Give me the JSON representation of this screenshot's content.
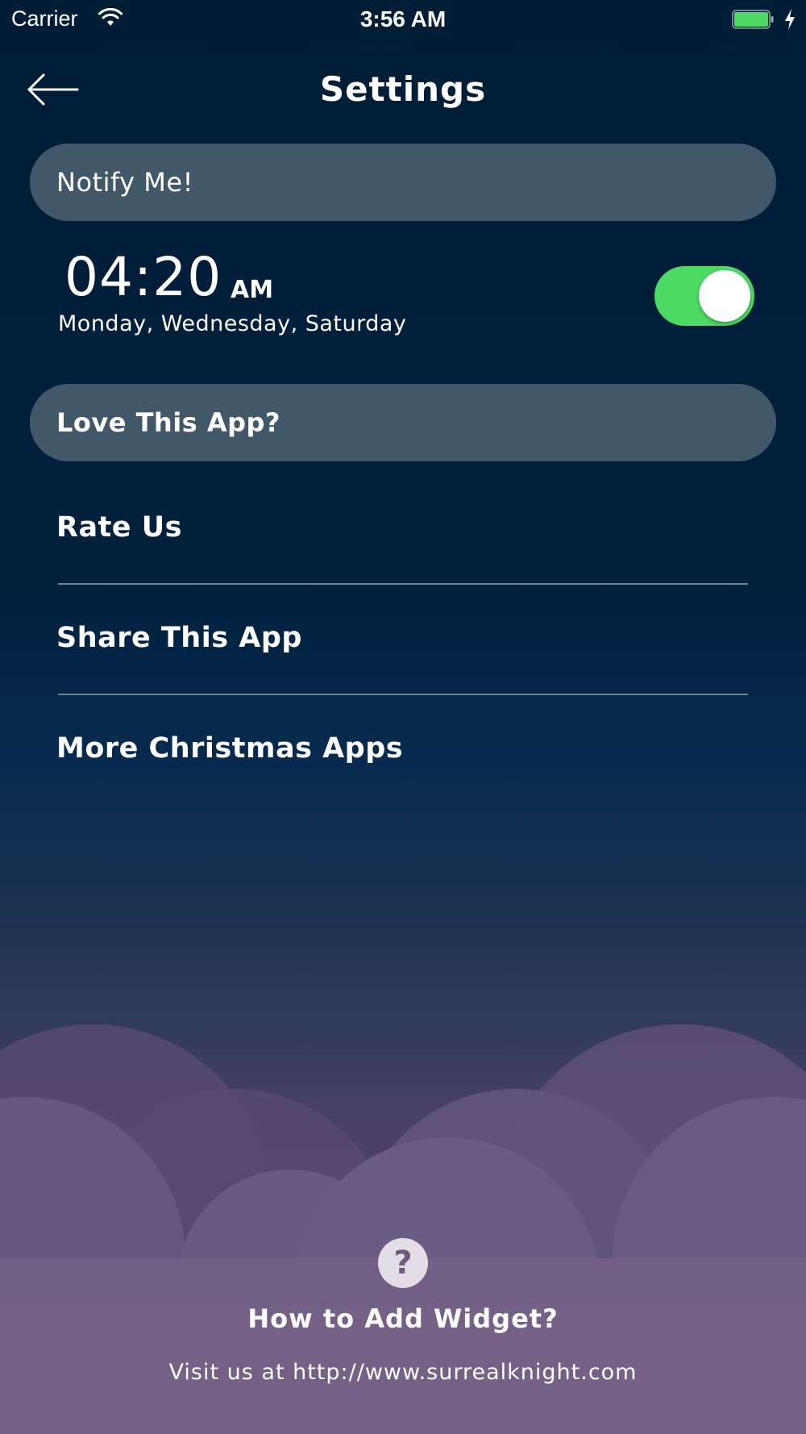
{
  "status_bar": {
    "carrier": "Carrier",
    "time": "3:56 AM",
    "icons": [
      "wifi-icon",
      "battery-icon",
      "charging-icon"
    ],
    "battery_color": "#4cd964"
  },
  "header": {
    "title": "Settings",
    "back_icon": "arrow-left-icon"
  },
  "notify_section": {
    "header": "Notify Me!",
    "alarm": {
      "time": "04:20",
      "period": "AM",
      "days": "Monday, Wednesday, Saturday",
      "enabled": true
    }
  },
  "love_section": {
    "header": "Love This App?",
    "items": [
      {
        "label": "Rate Us"
      },
      {
        "label": "Share This App"
      },
      {
        "label": "More Christmas Apps"
      }
    ]
  },
  "footer": {
    "help_icon_glyph": "?",
    "widget_link": "How to Add Widget?",
    "website": "Visit us at http://www.surrealknight.com"
  },
  "colors": {
    "background_top": "#001d36",
    "section_header": "#415869",
    "toggle_on": "#4cd964",
    "cloud": "#6a5a80"
  }
}
